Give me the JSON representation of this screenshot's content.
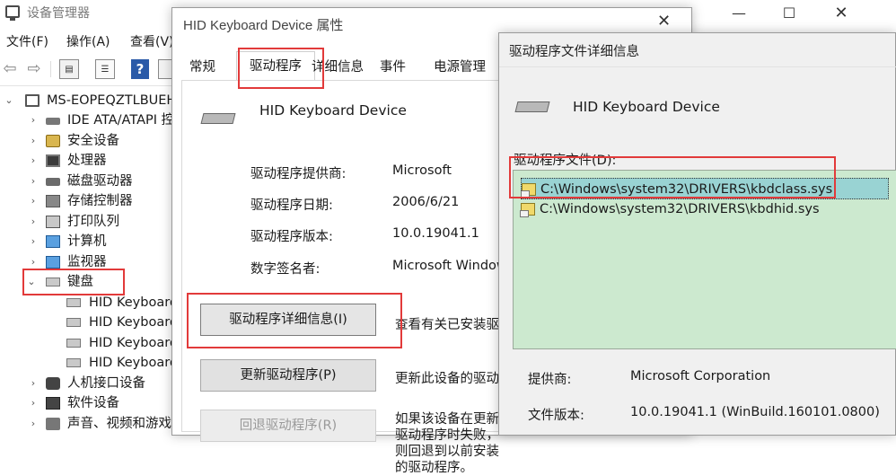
{
  "device_manager": {
    "title": "设备管理器",
    "window_controls": {
      "minimize": "—",
      "maximize": "☐",
      "close": "✕"
    },
    "menu": {
      "file": "文件(F)",
      "action": "操作(A)",
      "view": "查看(V)"
    },
    "tree": {
      "root": "MS-EOPEQZTLBUEH",
      "categories": [
        {
          "label": "IDE ATA/ATAPI 控制器",
          "icon": "ide-controller-icon",
          "expanded": false
        },
        {
          "label": "安全设备",
          "icon": "security-device-icon",
          "expanded": false
        },
        {
          "label": "处理器",
          "icon": "processor-icon",
          "expanded": false
        },
        {
          "label": "磁盘驱动器",
          "icon": "disk-drive-icon",
          "expanded": false
        },
        {
          "label": "存储控制器",
          "icon": "storage-controller-icon",
          "expanded": false
        },
        {
          "label": "打印队列",
          "icon": "printer-icon",
          "expanded": false
        },
        {
          "label": "计算机",
          "icon": "computer-icon",
          "expanded": false
        },
        {
          "label": "监视器",
          "icon": "monitor-icon",
          "expanded": false
        },
        {
          "label": "键盘",
          "icon": "keyboard-icon",
          "expanded": true
        },
        {
          "label": "人机接口设备",
          "icon": "hid-icon",
          "expanded": false
        },
        {
          "label": "软件设备",
          "icon": "software-device-icon",
          "expanded": false
        },
        {
          "label": "声音、视频和游戏控制器",
          "icon": "audio-icon",
          "expanded": false
        }
      ],
      "keyboard_children": [
        "HID Keyboard Device",
        "HID Keyboard Device",
        "HID Keyboard Device",
        "HID Keyboard Device"
      ]
    }
  },
  "properties_dialog": {
    "title": "HID Keyboard Device 属性",
    "close": "✕",
    "tabs": [
      "常规",
      "驱动程序",
      "详细信息",
      "事件",
      "电源管理"
    ],
    "active_tab": "驱动程序",
    "device_name": "HID Keyboard Device",
    "info": [
      {
        "label": "驱动程序提供商:",
        "value": "Microsoft"
      },
      {
        "label": "驱动程序日期:",
        "value": "2006/6/21"
      },
      {
        "label": "驱动程序版本:",
        "value": "10.0.19041.1"
      },
      {
        "label": "数字签名者:",
        "value": "Microsoft Windows"
      }
    ],
    "buttons": {
      "details": "驱动程序详细信息(I)",
      "update": "更新驱动程序(P)",
      "rollback": "回退驱动程序(R)"
    },
    "descriptions": {
      "details": "查看有关已安装驱动程序文件的详细信息。",
      "update": "更新此设备的驱动程序。",
      "rollback": "如果该设备在更新驱动程序时失败，则回退到以前安装的驱动程序。"
    }
  },
  "driver_file_details": {
    "title": "驱动程序文件详细信息",
    "device_name": "HID Keyboard Device",
    "files_label": "驱动程序文件(D):",
    "files": [
      {
        "path": "C:\\Windows\\system32\\DRIVERS\\kbdclass.sys",
        "selected": true
      },
      {
        "path": "C:\\Windows\\system32\\DRIVERS\\kbdhid.sys",
        "selected": false
      }
    ],
    "provider_label": "提供商:",
    "provider_value": "Microsoft Corporation",
    "version_label": "文件版本:",
    "version_value": "10.0.19041.1 (WinBuild.160101.0800)"
  },
  "colors": {
    "highlight_box": "#e23a3a",
    "file_list_bg": "#cce9cf",
    "file_selected_bg": "#99d3d3",
    "help_icon": "#2a5aa8"
  }
}
